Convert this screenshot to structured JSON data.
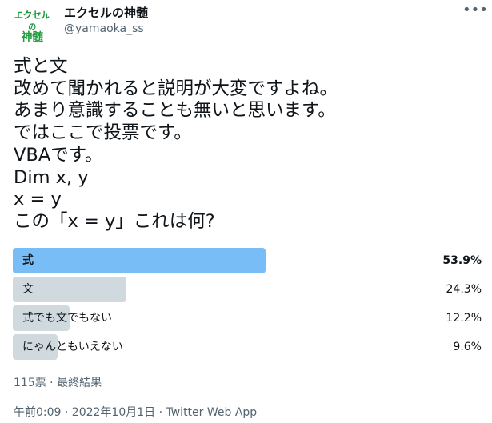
{
  "author": {
    "avatar_text": [
      "エクセル",
      "の",
      "神髄"
    ],
    "display_name": "エクセルの神髄",
    "handle": "@yamaoka_ss"
  },
  "menu": {
    "more_icon": "•••"
  },
  "tweet": {
    "lines": [
      "式と文",
      "改めて聞かれると説明が大変ですよね。",
      "あまり意識することも無いと思います。",
      "ではここで投票です。",
      "VBAです。",
      "Dim x, y",
      "x = y",
      "この「x = y」これは何?"
    ]
  },
  "poll": {
    "options": [
      {
        "label": "式",
        "percent": "53.9%",
        "value": 53.9,
        "winner": true
      },
      {
        "label": "文",
        "percent": "24.3%",
        "value": 24.3,
        "winner": false
      },
      {
        "label": "式でも文でもない",
        "percent": "12.2%",
        "value": 12.2,
        "winner": false
      },
      {
        "label": "にゃんともいえない",
        "percent": "9.6%",
        "value": 9.6,
        "winner": false
      }
    ],
    "summary": "115票 · 最終結果",
    "colors": {
      "winner_bar": "#78bdf6",
      "other_bar": "#cfd9de"
    }
  },
  "footer": {
    "timestamp": "午前0:09 · 2022年10月1日 · Twitter Web App"
  }
}
